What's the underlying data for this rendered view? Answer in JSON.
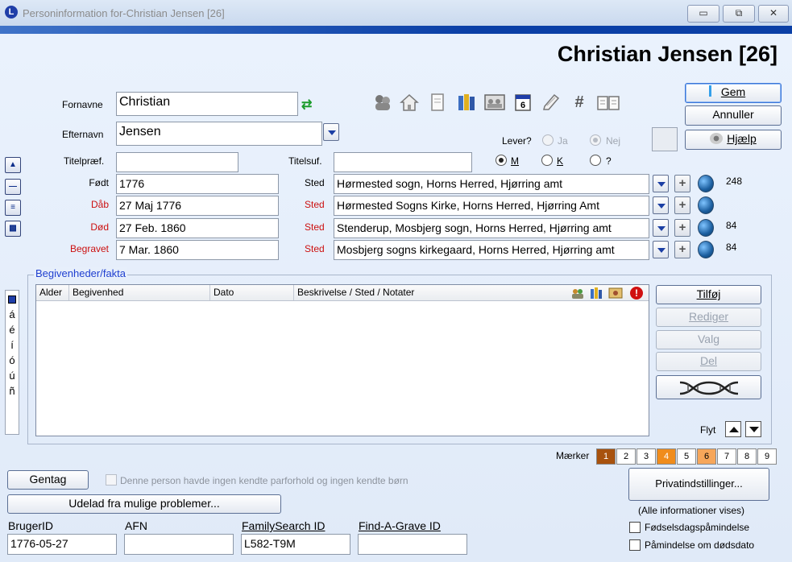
{
  "window": {
    "app_icon_letter": "L",
    "title": "Personinformation for-Christian Jensen [26]",
    "minimize_glyph": "▭",
    "restore_glyph": "⧉",
    "close_glyph": "✕"
  },
  "heading": "Christian Jensen [26]",
  "names": {
    "fornavne_label": "Fornavne",
    "fornavne_value": "Christian",
    "efternavn_label": "Efternavn",
    "efternavn_value": "Jensen",
    "titelpraef_label": "Titelpræf.",
    "titelpraef_value": "",
    "titelsuf_label": "Titelsuf.",
    "titelsuf_value": ""
  },
  "toolbar_icons": [
    "persons-icon",
    "house-icon",
    "document-icon",
    "books-icon",
    "photo-icon",
    "calendar-icon",
    "notes-icon",
    "hash-icon",
    "book-open-icon"
  ],
  "calendar_icon_number": "6",
  "hash_glyph": "#",
  "lever": {
    "label": "Lever?",
    "ja": "Ja",
    "nej": "Nej",
    "selected": "Nej"
  },
  "gender": {
    "m": "M",
    "k": "K",
    "unknown": "?",
    "selected": "M"
  },
  "buttons": {
    "gem": "Gem",
    "annuller": "Annuller",
    "hjaelp": "Hjælp",
    "tilfoej": "Tilføj",
    "rediger": "Rediger",
    "valg": "Valg",
    "del": "Del",
    "gentag": "Gentag",
    "udelad": "Udelad fra mulige problemer...",
    "privat": "Privatindstillinger..."
  },
  "side_buttons": [
    "▲",
    "—",
    "≡",
    "▩"
  ],
  "events": [
    {
      "label": "Født",
      "red": false,
      "date": "1776",
      "sted_label": "Sted",
      "sted_red": false,
      "place": "Hørmested sogn, Horns Herred, Hjørring amt",
      "count": "248"
    },
    {
      "label": "Dåb",
      "red": true,
      "date": "27 Maj 1776",
      "sted_label": "Sted",
      "sted_red": true,
      "place": "Hørmested Sogns Kirke, Horns Herred, Hjørring Amt",
      "count": ""
    },
    {
      "label": "Død",
      "red": true,
      "date": "27 Feb. 1860",
      "sted_label": "Sted",
      "sted_red": true,
      "place": "Stenderup, Mosbjerg sogn, Horns Herred, Hjørring amt",
      "count": "84"
    },
    {
      "label": "Begravet",
      "red": true,
      "date": "7 Mar. 1860",
      "sted_label": "Sted",
      "sted_red": true,
      "place": "Mosbjerg sogns kirkegaard, Horns Herred, Hjørring amt",
      "count": "84"
    }
  ],
  "plus_glyph": "+",
  "facts": {
    "legend": "Begivenheder/fakta",
    "columns": [
      "Alder",
      "Begivenhed",
      "Dato",
      "Beskrivelse / Sted / Notater"
    ],
    "rows": []
  },
  "accent_chars": [
    "á",
    "é",
    "í",
    "ó",
    "ú",
    "ñ"
  ],
  "flyt_label": "Flyt",
  "markers": {
    "label": "Mærker",
    "items": [
      {
        "n": "1",
        "color": "#a8520e",
        "text_color": "#ffffff"
      },
      {
        "n": "2",
        "color": "#ffffff",
        "text_color": "#000000"
      },
      {
        "n": "3",
        "color": "#ffffff",
        "text_color": "#000000"
      },
      {
        "n": "4",
        "color": "#f08c1c",
        "text_color": "#ffffff"
      },
      {
        "n": "5",
        "color": "#ffffff",
        "text_color": "#000000"
      },
      {
        "n": "6",
        "color": "#f6a65a",
        "text_color": "#000000"
      },
      {
        "n": "7",
        "color": "#ffffff",
        "text_color": "#000000"
      },
      {
        "n": "8",
        "color": "#ffffff",
        "text_color": "#000000"
      },
      {
        "n": "9",
        "color": "#ffffff",
        "text_color": "#000000"
      }
    ]
  },
  "no_spouse_text": "Denne person havde ingen kendte parforhold og ingen kendte børn",
  "ids": {
    "brugerid_label": "BrugerID",
    "brugerid_value": "1776-05-27",
    "afn_label": "AFN",
    "afn_value": "",
    "familysearch_label": "FamilySearch ID",
    "familysearch_value": "L582-T9M",
    "findagrave_label": "Find-A-Grave ID",
    "findagrave_value": ""
  },
  "privacy_note": "(Alle informationer vises)",
  "reminders": {
    "birthday": "Fødselsdagspåmindelse",
    "deathdate": "Påmindelse om dødsdato"
  }
}
